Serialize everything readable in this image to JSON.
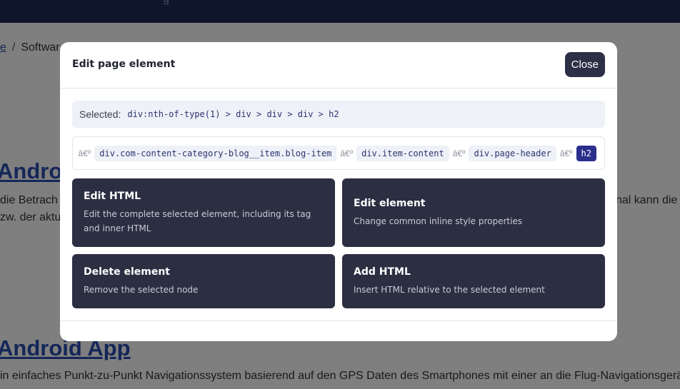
{
  "background": {
    "topbar_fragment": "g",
    "breadcrumb": {
      "link": "e",
      "separator": "/",
      "current": "Softwar"
    },
    "heading1": "Androi",
    "text1_left": "die Betrach",
    "text1_right": "nal kann die",
    "text2_left": "zw. der aktu",
    "heading2": "Android App",
    "text3": "in einfaches Punkt-zu-Punkt Navigationssystem basierend auf den GPS Daten des Smartphones mit einer an die Flug-Navigationsgerä"
  },
  "modal": {
    "title": "Edit page element",
    "close_label": "Close",
    "selected_label": "Selected:",
    "selected_value": "div:nth-of-type(1) > div > div > div > h2",
    "crumb_separator": "â€º",
    "crumbs": [
      "div.com-content-category-blog__item.blog-item",
      "div.item-content",
      "div.page-header",
      "h2"
    ],
    "actions": [
      {
        "title": "Edit HTML",
        "desc": "Edit the complete selected element, including its tag and inner HTML"
      },
      {
        "title": "Edit element",
        "desc": "Change common inline style properties"
      },
      {
        "title": "Delete element",
        "desc": "Remove the selected node"
      },
      {
        "title": "Add HTML",
        "desc": "Insert HTML relative to the selected element"
      }
    ]
  },
  "colors": {
    "overlay": "rgba(0,0,0,0.5)",
    "card_bg": "#2c2e42",
    "active_chip": "#2a2f8c",
    "link": "#2a4fb0"
  }
}
